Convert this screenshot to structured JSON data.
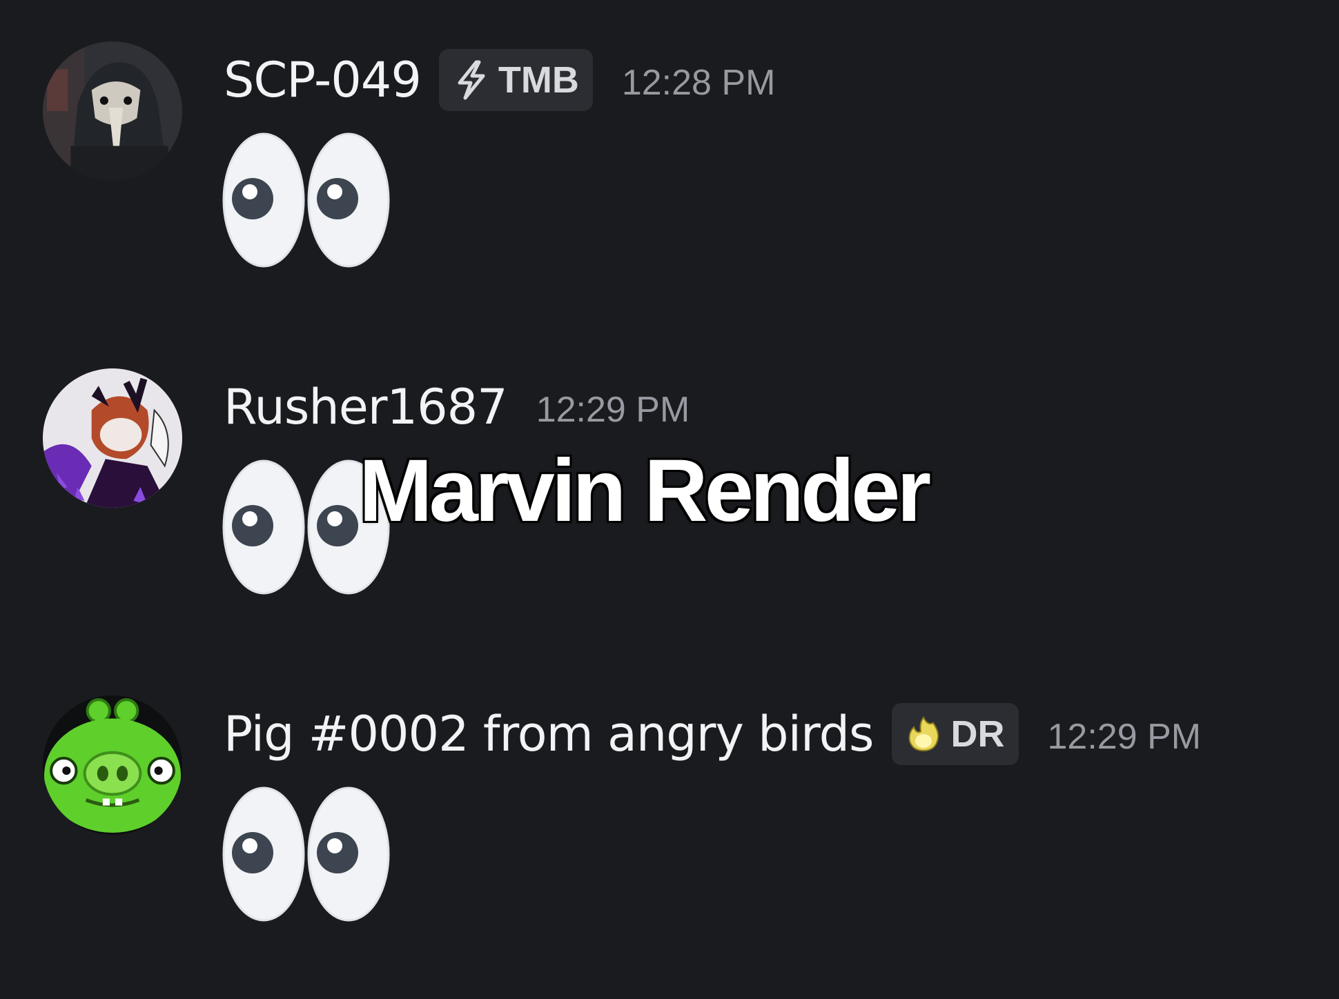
{
  "messages": [
    {
      "username": "SCP-049",
      "tag": {
        "label": "TMB",
        "icon": "lightning-icon"
      },
      "timestamp": "12:28 PM",
      "avatar": "plague-doctor-avatar",
      "content_emoji": "eyes-emoji"
    },
    {
      "username": "Rusher1687",
      "timestamp": "12:29 PM",
      "avatar": "purple-character-avatar",
      "content_emoji": "eyes-emoji"
    },
    {
      "username": "Pig #0002 from angry birds",
      "tag": {
        "label": "DR",
        "icon": "flame-icon"
      },
      "timestamp": "12:29 PM",
      "avatar": "green-pig-avatar",
      "content_emoji": "eyes-emoji"
    }
  ],
  "watermark": "Marvin Render",
  "colors": {
    "background": "#1a1b1f",
    "username": "#f2f3f5",
    "timestamp": "#989aa1",
    "tag_background": "#2b2d33"
  }
}
